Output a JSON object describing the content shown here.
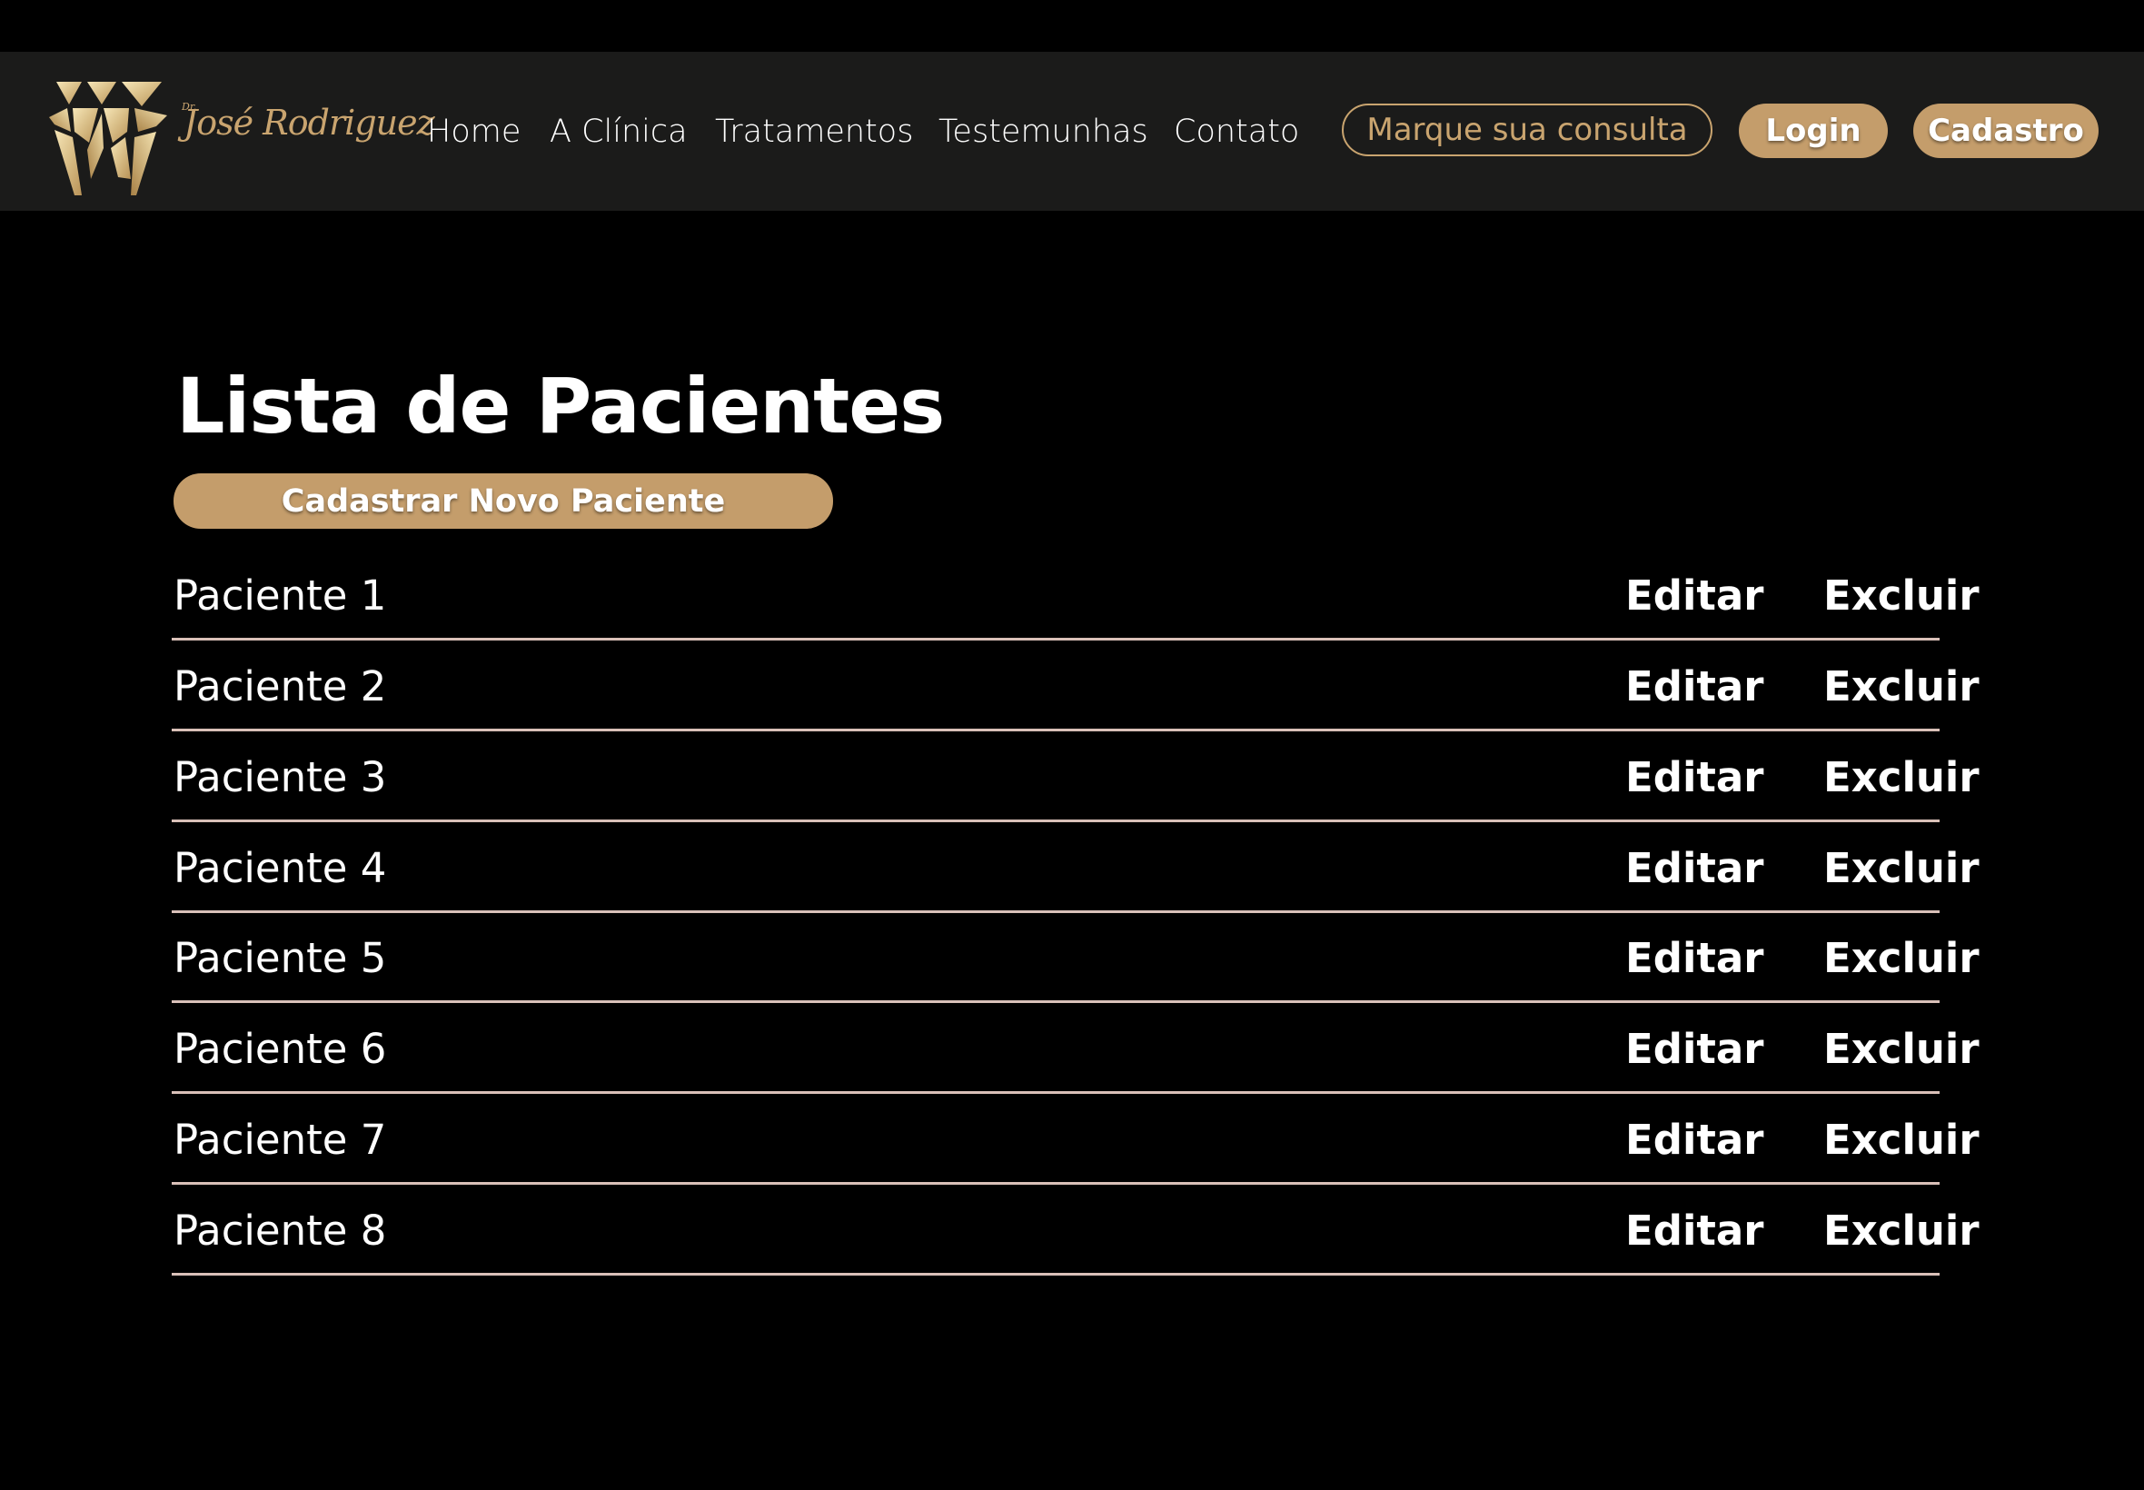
{
  "header": {
    "logo": {
      "prefix": "Dr.",
      "name": "José Rodriguez"
    },
    "nav": [
      {
        "label": "Home"
      },
      {
        "label": "A Clínica"
      },
      {
        "label": "Tratamentos"
      },
      {
        "label": "Testemunhas"
      },
      {
        "label": "Contato"
      }
    ],
    "cta_label": "Marque sua consulta",
    "login_label": "Login",
    "signup_label": "Cadastro"
  },
  "main": {
    "title": "Lista de Pacientes",
    "new_patient_label": "Cadastrar Novo Paciente",
    "edit_label": "Editar",
    "delete_label": "Excluir",
    "patients": [
      {
        "name": "Paciente 1"
      },
      {
        "name": "Paciente 2"
      },
      {
        "name": "Paciente 3"
      },
      {
        "name": "Paciente 4"
      },
      {
        "name": "Paciente 5"
      },
      {
        "name": "Paciente 6"
      },
      {
        "name": "Paciente 7"
      },
      {
        "name": "Paciente 8"
      }
    ]
  },
  "colors": {
    "accent": "#c49d6b",
    "header_bg": "#1b1b1a",
    "background": "#000000",
    "divider": "#d9c0b8"
  }
}
